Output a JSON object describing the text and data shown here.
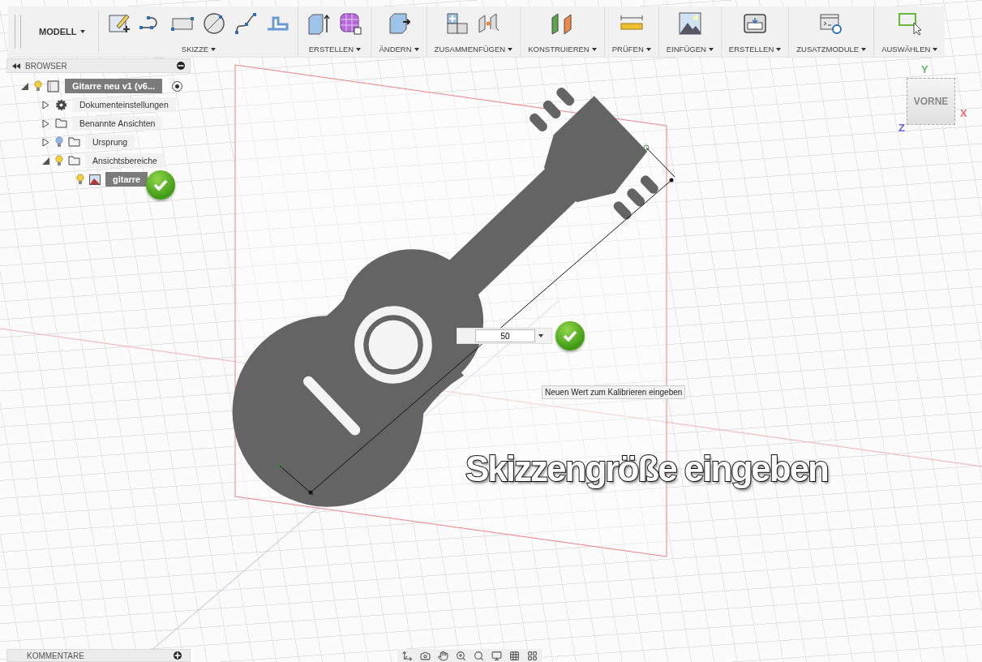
{
  "toolbar": {
    "workspace": "MODELL",
    "groups": [
      {
        "label": "SKIZZE"
      },
      {
        "label": "ERSTELLEN"
      },
      {
        "label": "ÄNDERN"
      },
      {
        "label": "ZUSAMMENFÜGEN"
      },
      {
        "label": "KONSTRUIEREN"
      },
      {
        "label": "PRÜFEN"
      },
      {
        "label": "EINFÜGEN"
      },
      {
        "label": "ERSTELLEN"
      },
      {
        "label": "ZUSATZMODULE"
      },
      {
        "label": "AUSWÄHLEN"
      }
    ]
  },
  "browser": {
    "title": "BROWSER",
    "tree": [
      {
        "label": "Gitarre neu v1 (v6...",
        "kind": "component",
        "bulb": true,
        "lit": true,
        "expanded": true,
        "selected": true,
        "children": [
          {
            "label": "Dokumenteinstellungen",
            "kind": "settings",
            "bulb": false,
            "expanded": false,
            "selected": false
          },
          {
            "label": "Benannte Ansichten",
            "kind": "folder",
            "bulb": false,
            "expanded": false,
            "selected": false
          },
          {
            "label": "Ursprung",
            "kind": "folder",
            "bulb": true,
            "lit": false,
            "expanded": false,
            "selected": false
          },
          {
            "label": "Ansichtsbereiche",
            "kind": "folder",
            "bulb": true,
            "lit": true,
            "expanded": true,
            "selected": false,
            "children": [
              {
                "label": "gitarre",
                "kind": "image",
                "bulb": true,
                "lit": true,
                "selected": true
              }
            ]
          }
        ]
      }
    ]
  },
  "dimension_input": {
    "value": "50"
  },
  "tooltip": "Neuen Wert zum Kalibrieren eingeben",
  "caption": "Skizzengröße eingeben",
  "view_cube": {
    "face": "VORNE",
    "axis_x": "X",
    "axis_y": "Y",
    "axis_z": "Z"
  },
  "comments_panel": {
    "title": "KOMMENTARE"
  }
}
